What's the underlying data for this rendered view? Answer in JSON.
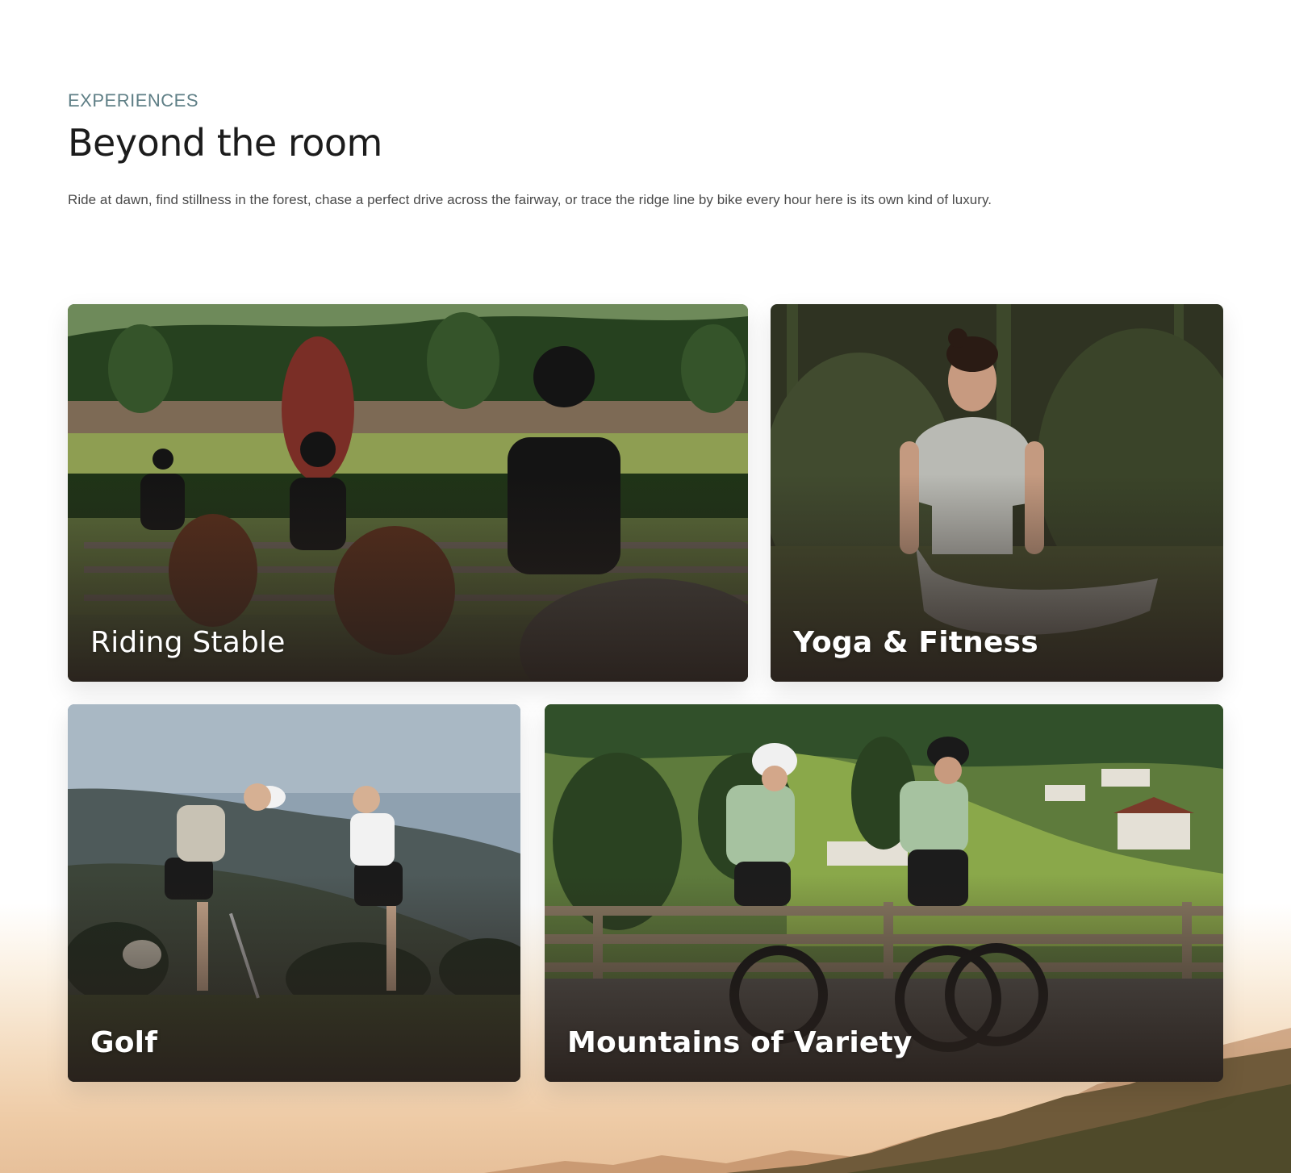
{
  "section": {
    "eyebrow": "EXPERIENCES",
    "title": "Beyond the room",
    "lede": "Ride at dawn, find stillness in the forest, chase a perfect drive across the fairway, or trace the ridge line by bike  every hour here is its own kind of luxury."
  },
  "cards": [
    {
      "label": "Riding Stable"
    },
    {
      "label": "Yoga & Fitness"
    },
    {
      "label": "Golf"
    },
    {
      "label": "Mountains of Variety"
    }
  ]
}
